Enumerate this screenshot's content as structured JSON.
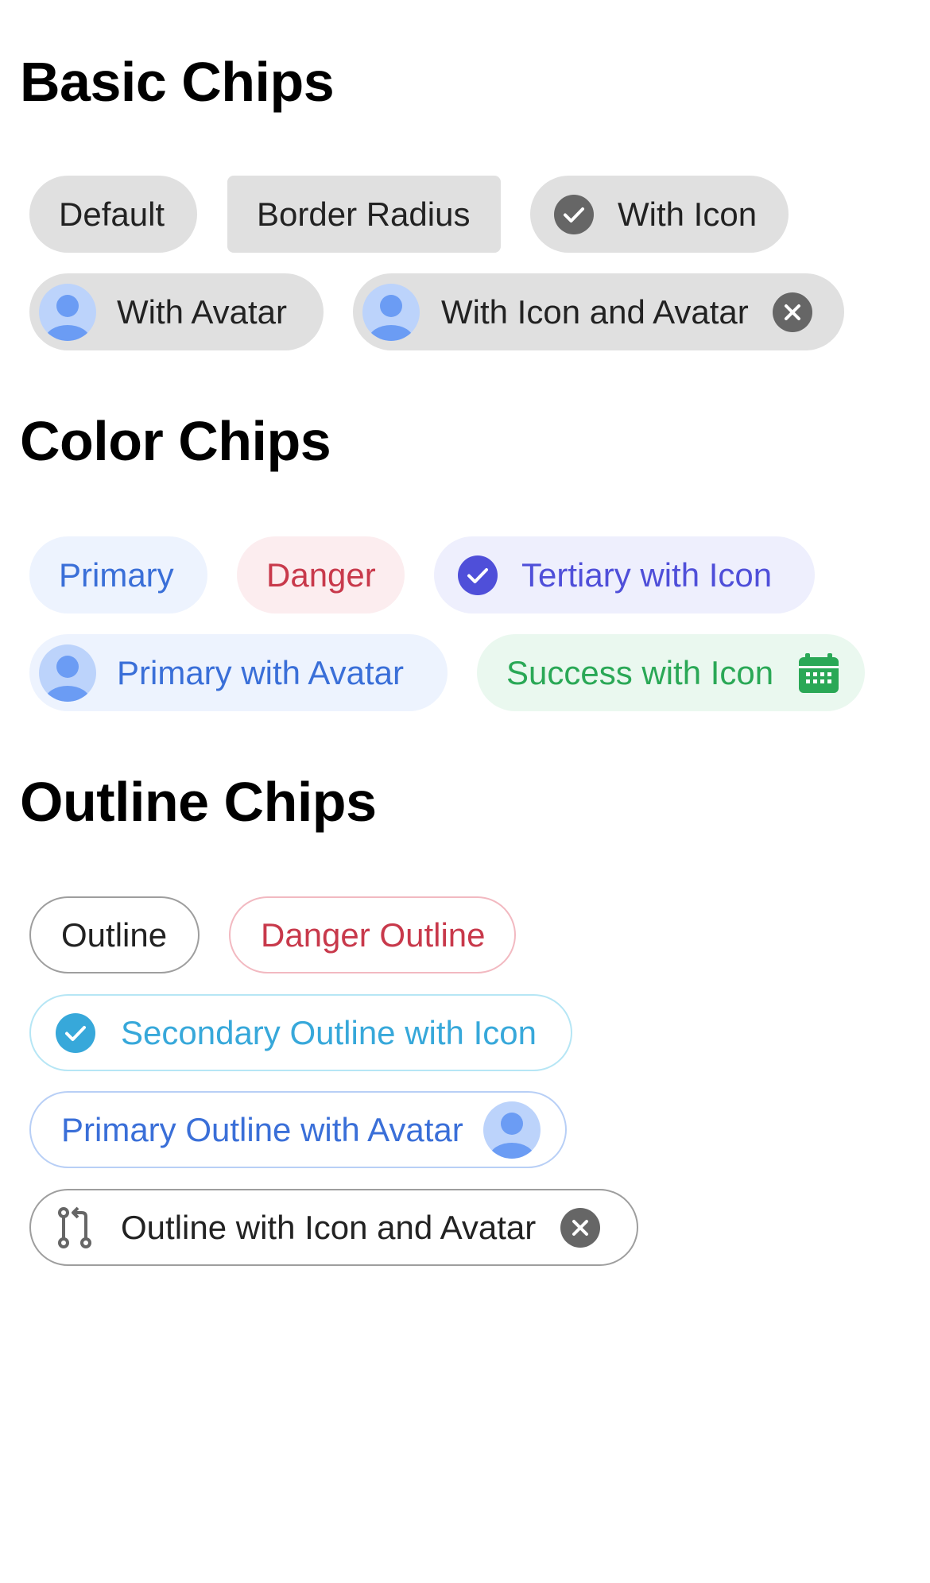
{
  "sections": {
    "basic": {
      "title": "Basic Chips"
    },
    "color": {
      "title": "Color Chips"
    },
    "outline": {
      "title": "Outline Chips"
    }
  },
  "basic_chips": {
    "default": "Default",
    "border_radius": "Border Radius",
    "with_icon": "With Icon",
    "with_avatar": "With Avatar",
    "with_icon_and_avatar": "With Icon and Avatar"
  },
  "color_chips": {
    "primary": "Primary",
    "danger": "Danger",
    "tertiary_with_icon": "Tertiary with Icon",
    "primary_with_avatar": "Primary with Avatar",
    "success_with_icon": "Success with Icon"
  },
  "outline_chips": {
    "outline": "Outline",
    "danger_outline": "Danger Outline",
    "secondary_outline_with_icon": "Secondary Outline with Icon",
    "primary_outline_with_avatar": "Primary Outline with Avatar",
    "outline_with_icon_and_avatar": "Outline with Icon and Avatar"
  },
  "icons": {
    "check": "checkmark-circle-icon",
    "close": "close-circle-icon",
    "calendar": "calendar-icon",
    "pull_request": "git-pull-request-icon",
    "avatar": "person-avatar-icon"
  },
  "colors": {
    "basic_bg": "#e0e0e0",
    "primary": "#3a6fd8",
    "danger": "#c8394b",
    "tertiary": "#4f4fd9",
    "success": "#2aa856",
    "secondary": "#37a8da",
    "medium_gray": "#666666"
  }
}
